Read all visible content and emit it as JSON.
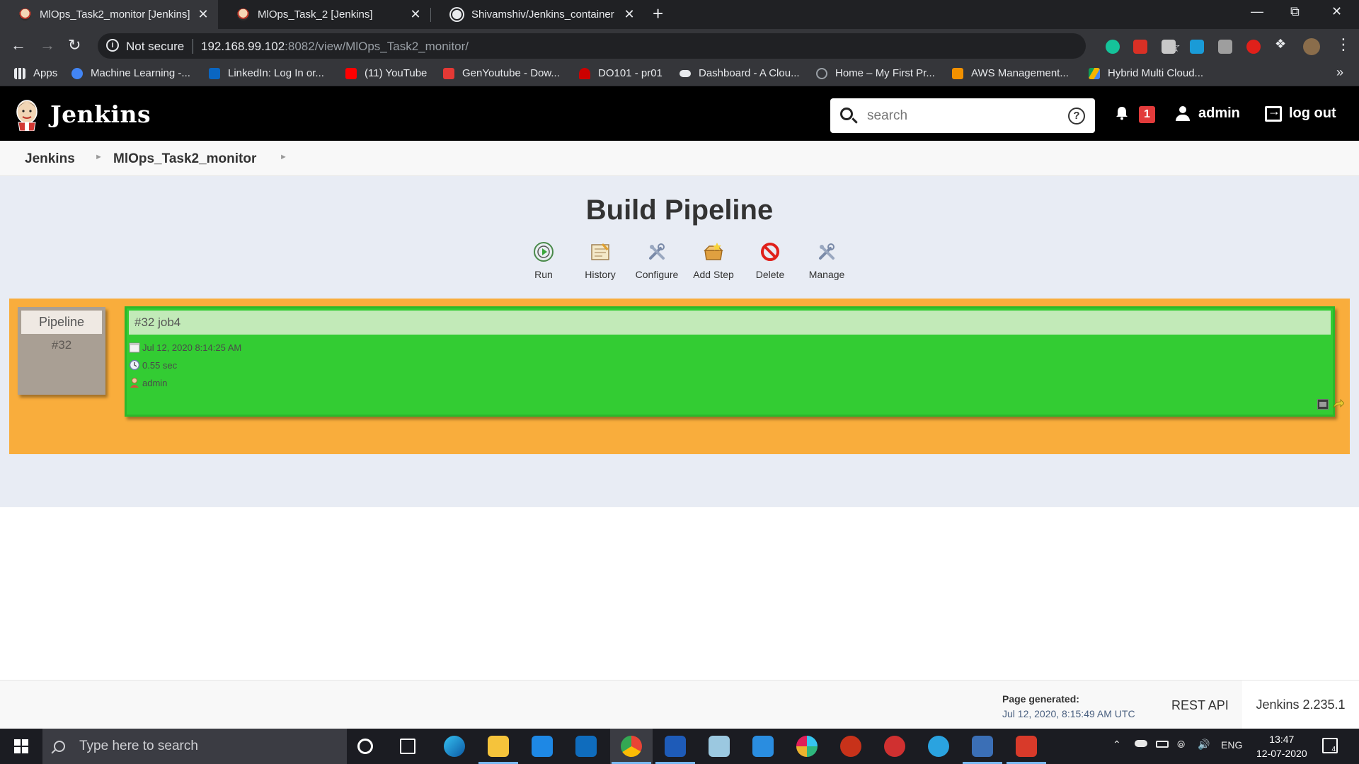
{
  "browser": {
    "tabs": [
      {
        "title": "MlOps_Task2_monitor [Jenkins]",
        "active": true
      },
      {
        "title": "MlOps_Task_2 [Jenkins]",
        "active": false
      },
      {
        "title": "Shivamshiv/Jenkins_container",
        "active": false
      }
    ],
    "new_tab_label": "+",
    "close_label": "✕",
    "security_label": "Not secure",
    "url_host": "192.168.99.102",
    "url_rest": ":8082/view/MlOps_Task2_monitor/",
    "bookmarks": [
      "Apps",
      "Machine Learning -...",
      "LinkedIn: Log In or...",
      "(11) YouTube",
      "GenYoutube - Dow...",
      "DO101 - pr01",
      "Dashboard - A Clou...",
      "Home – My First Pr...",
      "AWS Management...",
      "Hybrid Multi Cloud..."
    ],
    "bookmarks_more": "»"
  },
  "header": {
    "brand": "Jenkins",
    "search_placeholder": "search",
    "help_label": "?",
    "notification_count": "1",
    "user": "admin",
    "logout": "log out"
  },
  "breadcrumb": [
    "Jenkins",
    "MlOps_Task2_monitor"
  ],
  "page": {
    "title": "Build Pipeline",
    "tools": [
      {
        "label": "Run",
        "icon": "run-icon"
      },
      {
        "label": "History",
        "icon": "history-icon"
      },
      {
        "label": "Configure",
        "icon": "configure-icon"
      },
      {
        "label": "Add Step",
        "icon": "add-step-icon"
      },
      {
        "label": "Delete",
        "icon": "delete-icon"
      },
      {
        "label": "Manage",
        "icon": "manage-icon"
      }
    ]
  },
  "pipeline": {
    "label": "Pipeline",
    "number": "#32",
    "build": {
      "title": "#32 job4",
      "date": "Jul 12, 2020 8:14:25 AM",
      "duration": "0.55 sec",
      "user": "admin",
      "status": "success"
    }
  },
  "footer": {
    "generated_label": "Page generated:",
    "generated_time": "Jul 12, 2020, 8:15:49 AM UTC",
    "rest_api": "REST API",
    "version": "Jenkins 2.235.1"
  },
  "taskbar": {
    "search_placeholder": "Type here to search",
    "lang": "ENG",
    "time": "13:47",
    "date": "12-07-2020",
    "notification_count": "4"
  },
  "colors": {
    "board": "#f9ad3c",
    "build_success": "#33cc33",
    "build_header": "#c2eab8",
    "pipeline_box": "#a99f94",
    "jenkins_header": "#000000"
  }
}
